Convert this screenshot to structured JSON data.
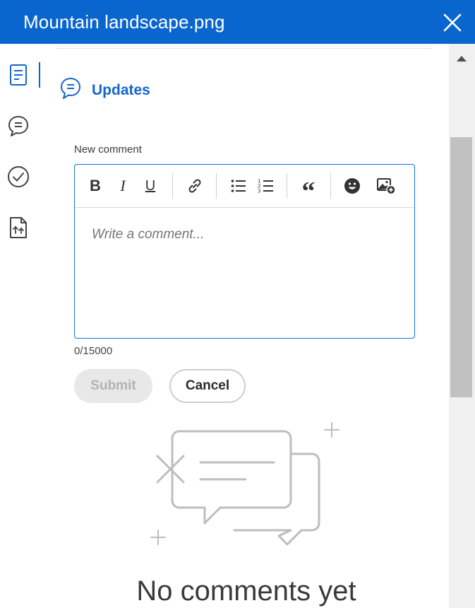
{
  "window": {
    "title": "Mountain landscape.png"
  },
  "rail": {
    "items": [
      "details-icon",
      "comments-icon",
      "approve-icon",
      "versions-icon"
    ],
    "active": "details-icon"
  },
  "section": {
    "title": "Updates"
  },
  "comment_form": {
    "label": "New comment",
    "placeholder": "Write a comment...",
    "toolbar": {
      "bold": "B",
      "italic": "I",
      "underline": "U",
      "quote": "“"
    },
    "counter": "0/15000",
    "submit_label": "Submit",
    "cancel_label": "Cancel"
  },
  "empty_state": {
    "text": "No comments yet"
  },
  "colors": {
    "accent": "#0a66cf",
    "heading": "#1366cc",
    "disabled_bg": "#e8e8e8"
  }
}
